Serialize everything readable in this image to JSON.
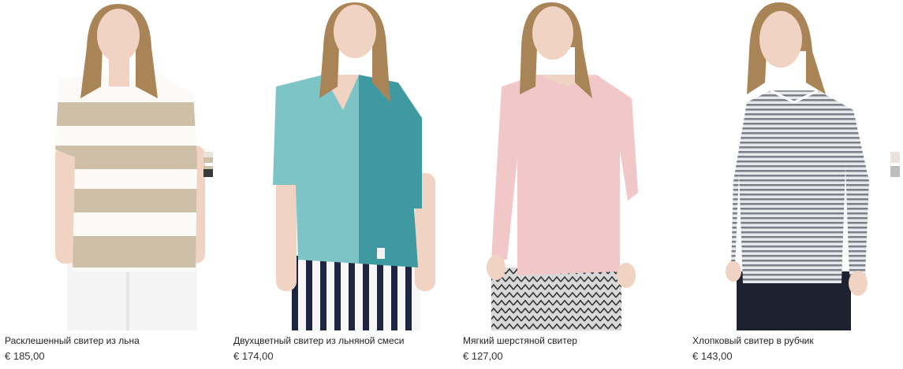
{
  "products": [
    {
      "name": "Расклешенный свитер из льна",
      "price": "€ 185,00",
      "swatches": [
        "#e9e3d8",
        "#3a3a3a"
      ],
      "image_icon": "product-photo"
    },
    {
      "name": "Двухцветный свитер из льняной смеси",
      "price": "€ 174,00",
      "swatches": [],
      "image_icon": "product-photo"
    },
    {
      "name": "Мягкий шерстяной свитер",
      "price": "€ 127,00",
      "swatches": [],
      "image_icon": "product-photo"
    },
    {
      "name": "Хлопковый свитер в рубчик",
      "price": "€ 143,00",
      "swatches": [
        "#e8e4dc",
        "#bdbdbd"
      ],
      "image_icon": "product-photo"
    }
  ],
  "colors": {
    "stripe_beige": "#cdbfa8",
    "teal_light": "#7cc4c6",
    "teal_dark": "#3e9aa0",
    "pink": "#f2c7c8",
    "grey_stripe": "#7a7e86",
    "hair": "#a98456",
    "skin": "#f1d3c3"
  }
}
